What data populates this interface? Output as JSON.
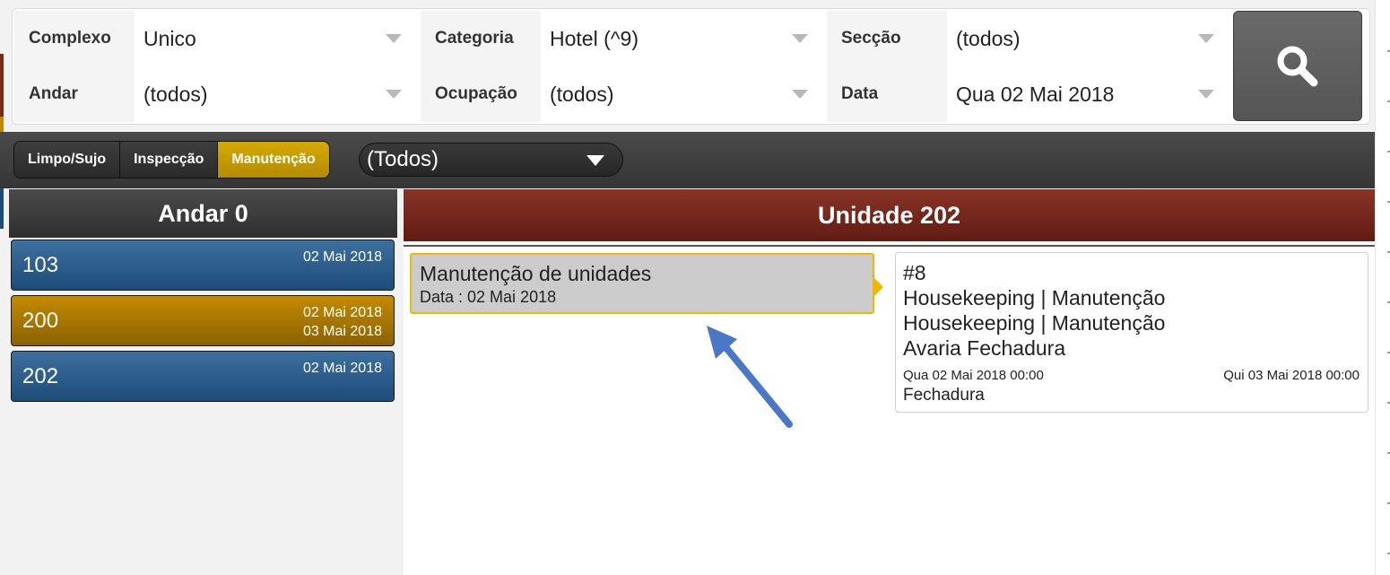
{
  "filters": {
    "complexo": {
      "label": "Complexo",
      "value": "Unico"
    },
    "andar": {
      "label": "Andar",
      "value": "(todos)"
    },
    "categoria": {
      "label": "Categoria",
      "value": "Hotel (^9)"
    },
    "ocupacao": {
      "label": "Ocupação",
      "value": "(todos)"
    },
    "seccao": {
      "label": "Secção",
      "value": "(todos)"
    },
    "data": {
      "label": "Data",
      "value": "Qua 02 Mai 2018"
    }
  },
  "search": {
    "icon": "search-icon"
  },
  "toolbar": {
    "segments": [
      {
        "label": "Limpo/Sujo",
        "active": false
      },
      {
        "label": "Inspecção",
        "active": false
      },
      {
        "label": "Manutenção",
        "active": true
      }
    ],
    "dropdown_value": "(Todos)",
    "active_color": "#c99e00"
  },
  "floor": {
    "header": "Andar 0",
    "units": [
      {
        "number": "103",
        "dates": [
          "02 Mai 2018"
        ],
        "color": "blue"
      },
      {
        "number": "200",
        "dates": [
          "02 Mai 2018",
          "03 Mai 2018"
        ],
        "color": "gold"
      },
      {
        "number": "202",
        "dates": [
          "02 Mai 2018"
        ],
        "color": "blue"
      }
    ]
  },
  "unit_detail": {
    "header": "Unidade 202",
    "maintenance": {
      "title": "Manutenção de unidades",
      "date_line": "Data : 02 Mai 2018"
    },
    "task": {
      "id": "#8",
      "lines": [
        "Housekeeping | Manutenção",
        "Housekeeping | Manutenção",
        "Avaria Fechadura"
      ],
      "start": "Qua 02 Mai 2018 00:00",
      "end": "Qui 03 Mai 2018 00:00",
      "footer": "Fechadura"
    }
  },
  "annotation": {
    "arrow_color": "#4a78c7"
  }
}
